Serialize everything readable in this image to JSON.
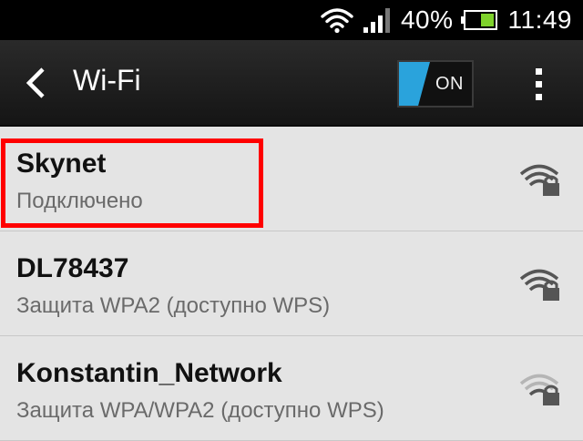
{
  "status_bar": {
    "battery_percent": "40%",
    "time": "11:49",
    "wifi_icon": "wifi-icon",
    "signal_icon": "signal-icon",
    "battery_icon": "battery-icon"
  },
  "action_bar": {
    "title": "Wi-Fi",
    "toggle_label": "ON",
    "back_icon": "chevron-left-icon",
    "menu_icon": "overflow-menu-icon"
  },
  "networks": [
    {
      "name": "Skynet",
      "status": "Подключено"
    },
    {
      "name": "DL78437",
      "status": "Защита WPA2 (доступно WPS)"
    },
    {
      "name": "Konstantin_Network",
      "status": "Защита WPA/WPA2 (доступно WPS)"
    }
  ],
  "colors": {
    "toggle_accent": "#2aa3dc",
    "highlight": "#ff0000",
    "battery_fill": "#7fd22c"
  }
}
